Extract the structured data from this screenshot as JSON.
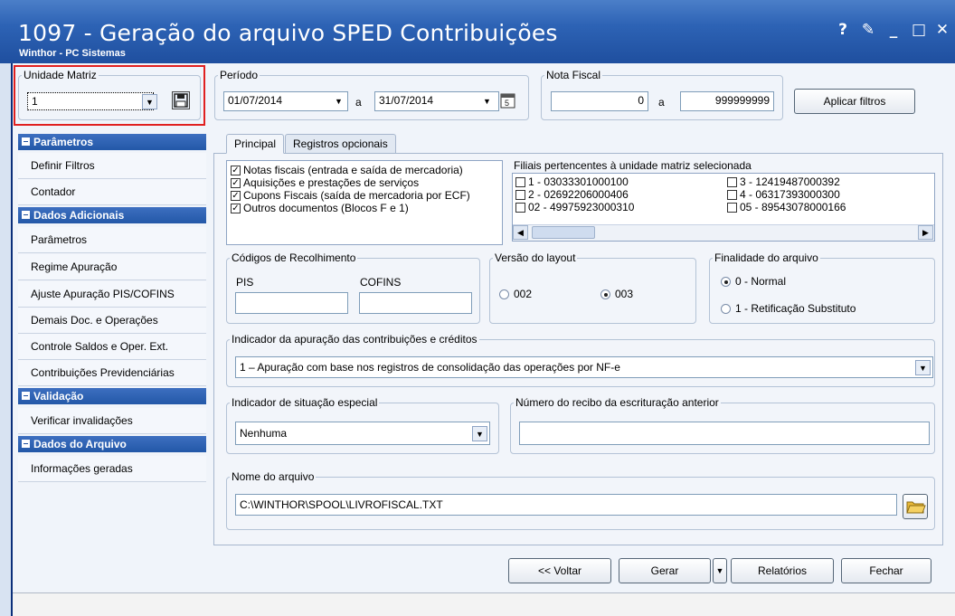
{
  "window": {
    "title": "1097 - Geração do arquivo SPED Contribuições",
    "subtitle": "Winthor - PC Sistemas",
    "controls": [
      "?",
      "✎",
      "_",
      "□",
      "✕"
    ]
  },
  "unidade_matriz": {
    "label": "Unidade Matriz",
    "value": "1"
  },
  "periodo": {
    "label": "Período",
    "start": "01/07/2014",
    "sep": "a",
    "end": "31/07/2014"
  },
  "nota_fiscal": {
    "label": "Nota Fiscal",
    "start": "0",
    "sep": "a",
    "end": "999999999"
  },
  "aplicar_filtros": "Aplicar filtros",
  "sidebar": {
    "sections": [
      {
        "title": "Parâmetros",
        "items": [
          "Definir Filtros",
          "Contador"
        ]
      },
      {
        "title": "Dados Adicionais",
        "items": [
          "Parâmetros",
          "Regime Apuração",
          "Ajuste Apuração PIS/COFINS",
          "Demais Doc. e Operações",
          "Controle Saldos e Oper. Ext.",
          "Contribuições Previdenciárias"
        ]
      },
      {
        "title": "Validação",
        "items": [
          "Verificar invalidações"
        ]
      },
      {
        "title": "Dados do Arquivo",
        "items": [
          "Informações geradas"
        ]
      }
    ]
  },
  "tabs": [
    "Principal",
    "Registros opcionais"
  ],
  "documents": [
    {
      "label": "Notas fiscais (entrada e saída de mercadoria)",
      "checked": true
    },
    {
      "label": "Aquisições e prestações de serviços",
      "checked": true
    },
    {
      "label": "Cupons Fiscais (saída de mercadoria por ECF)",
      "checked": true
    },
    {
      "label": "Outros documentos (Blocos F e 1)",
      "checked": true
    }
  ],
  "filiais": {
    "label": "Filiais pertencentes à unidade matriz selecionada",
    "items": [
      "1 - 03033301000100",
      "2 - 02692206000406",
      "02 - 49975923000310",
      "3 - 12419487000392",
      "4 - 06317393000300",
      "05 - 89543078000166"
    ]
  },
  "codigos": {
    "label": "Códigos de Recolhimento",
    "pis": "PIS",
    "cofins": "COFINS",
    "pis_value": "",
    "cofins_value": ""
  },
  "versao": {
    "label": "Versão do layout",
    "options": [
      "002",
      "003"
    ],
    "selected": "003"
  },
  "finalidade": {
    "label": "Finalidade do arquivo",
    "options": [
      "0 - Normal",
      "1 - Retificação Substituto"
    ],
    "selected": "0 - Normal"
  },
  "indicador_apuracao": {
    "label": "Indicador da apuração das contribuições e créditos",
    "value": "1 – Apuração com base nos registros de consolidação das operações por NF-e"
  },
  "situacao_especial": {
    "label": "Indicador de situação especial",
    "value": "Nenhuma"
  },
  "recibo": {
    "label": "Número do recibo da escrituração anterior",
    "value": ""
  },
  "nome_arquivo": {
    "label": "Nome do arquivo",
    "value": "C:\\WINTHOR\\SPOOL\\LIVROFISCAL.TXT"
  },
  "buttons": {
    "voltar": "<< Voltar",
    "gerar": "Gerar",
    "relatorios": "Relatórios",
    "fechar": "Fechar"
  }
}
